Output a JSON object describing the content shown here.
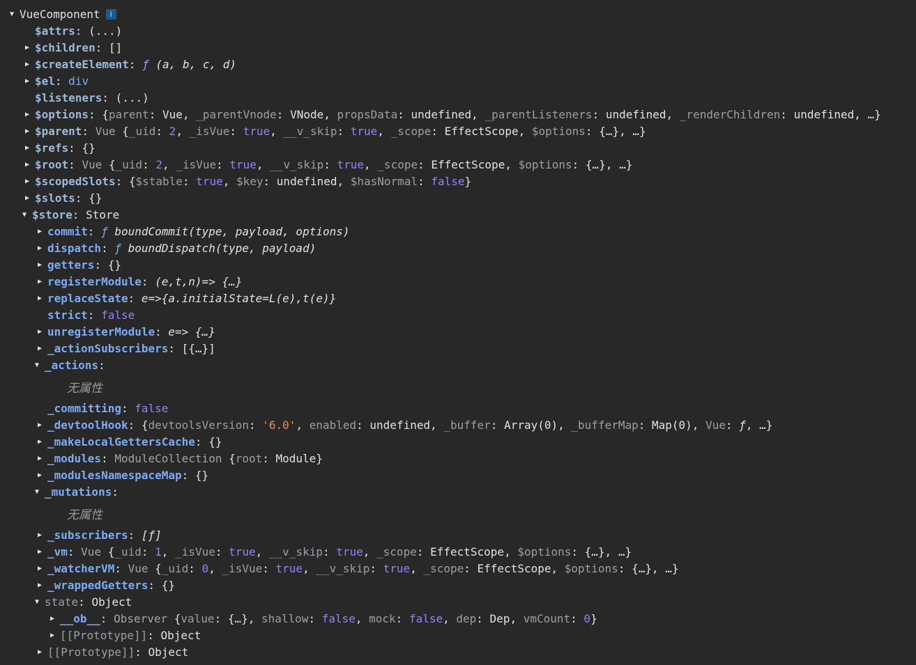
{
  "tree": {
    "root_label": "VueComponent",
    "info_badge": "i",
    "attrs": {
      "key": "$attrs",
      "value": "(...)"
    },
    "children": {
      "key": "$children",
      "value": "[]"
    },
    "createElement": {
      "key": "$createElement",
      "f": "ƒ",
      "sig": "(a, b, c, d)"
    },
    "el": {
      "key": "$el",
      "value": "div"
    },
    "listeners": {
      "key": "$listeners",
      "value": "(...)"
    },
    "options": {
      "key": "$options",
      "parts": [
        "{",
        "parent",
        ": ",
        "Vue",
        ", ",
        "_parentVnode",
        ": ",
        "VNode",
        ", ",
        "propsData",
        ": ",
        "undefined",
        ", ",
        "_parentListeners",
        ": ",
        "undefined",
        ", ",
        "_renderChildren",
        ": ",
        "undefined",
        ", …}"
      ]
    },
    "parent": {
      "key": "$parent",
      "cls": "Vue",
      "uid": "2",
      "isVue": "true",
      "vskip": "true",
      "scope": "EffectScope"
    },
    "refs": {
      "key": "$refs",
      "value": "{}"
    },
    "rootv": {
      "key": "$root",
      "cls": "Vue",
      "uid": "2",
      "isVue": "true",
      "vskip": "true",
      "scope": "EffectScope"
    },
    "scopedSlots": {
      "key": "$scopedSlots",
      "stable": "true",
      "keyv": "undefined",
      "hasNormal": "false"
    },
    "slots": {
      "key": "$slots",
      "value": "{}"
    },
    "store": {
      "key": "$store",
      "value": "Store",
      "commit": {
        "key": "commit",
        "f": "ƒ",
        "sig": "boundCommit(type, payload, options)"
      },
      "dispatch": {
        "key": "dispatch",
        "f": "ƒ",
        "sig": "boundDispatch(type, payload)"
      },
      "getters": {
        "key": "getters",
        "value": "{}"
      },
      "registerModule": {
        "key": "registerModule",
        "sig": "(e,t,n)=> {…}"
      },
      "replaceState": {
        "key": "replaceState",
        "sig": "e=>{a.initialState=L(e),t(e)}"
      },
      "strict": {
        "key": "strict",
        "value": "false"
      },
      "unregisterModule": {
        "key": "unregisterModule",
        "sig": "e=> {…}"
      },
      "actionSubscribers": {
        "key": "_actionSubscribers",
        "value": "[{…}]"
      },
      "actions": {
        "key": "_actions",
        "empty": "无属性"
      },
      "committing": {
        "key": "_committing",
        "value": "false"
      },
      "devtoolHook": {
        "key": "_devtoolHook",
        "version": "'6.0'",
        "enabled": "undefined",
        "buffer": "Array(0)",
        "bufferMap": "Map(0)",
        "vue": "ƒ"
      },
      "makeLocal": {
        "key": "_makeLocalGettersCache",
        "value": "{}"
      },
      "modules": {
        "key": "_modules",
        "cls": "ModuleCollection",
        "root": "Module"
      },
      "modulesNs": {
        "key": "_modulesNamespaceMap",
        "value": "{}"
      },
      "mutations": {
        "key": "_mutations",
        "empty": "无属性"
      },
      "subscribers": {
        "key": "_subscribers",
        "value": "[ƒ]"
      },
      "vm": {
        "key": "_vm",
        "cls": "Vue",
        "uid": "1",
        "isVue": "true",
        "vskip": "true",
        "scope": "EffectScope"
      },
      "watcherVM": {
        "key": "_watcherVM",
        "cls": "Vue",
        "uid": "0",
        "isVue": "true",
        "vskip": "true",
        "scope": "EffectScope"
      },
      "wrappedGetters": {
        "key": "_wrappedGetters",
        "value": "{}"
      },
      "state": {
        "key": "state",
        "value": "Object",
        "ob": {
          "key": "__ob__",
          "cls": "Observer",
          "valuev": "{…}",
          "shallow": "false",
          "mock": "false",
          "dep": "Dep",
          "vmCount": "0"
        },
        "proto": {
          "key": "[[Prototype]]",
          "value": "Object"
        }
      },
      "proto": {
        "key": "[[Prototype]]",
        "value": "Object"
      }
    }
  },
  "colors": {
    "background": "#282828",
    "key": "#9bbbdc",
    "keyword": "#9980ff",
    "string": "#f28b54"
  }
}
